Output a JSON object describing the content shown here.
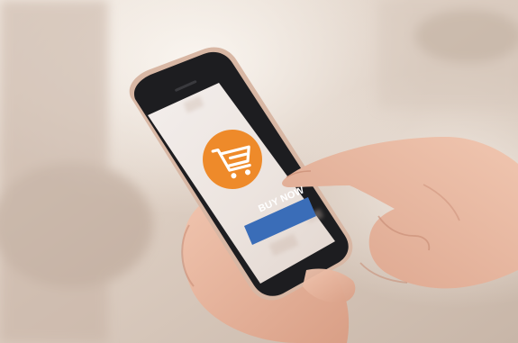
{
  "photo": {
    "screen": {
      "cart_icon": "shopping-cart-icon",
      "button_label": "BUY NOW"
    }
  },
  "colors": {
    "accent_orange": "#ee8a2a",
    "button_blue": "#3a6db8",
    "phone_body": "#1c1c1e",
    "phone_frame": "#d7b6a3",
    "skin": "#e7b49d",
    "background": "#e8dcd2"
  }
}
